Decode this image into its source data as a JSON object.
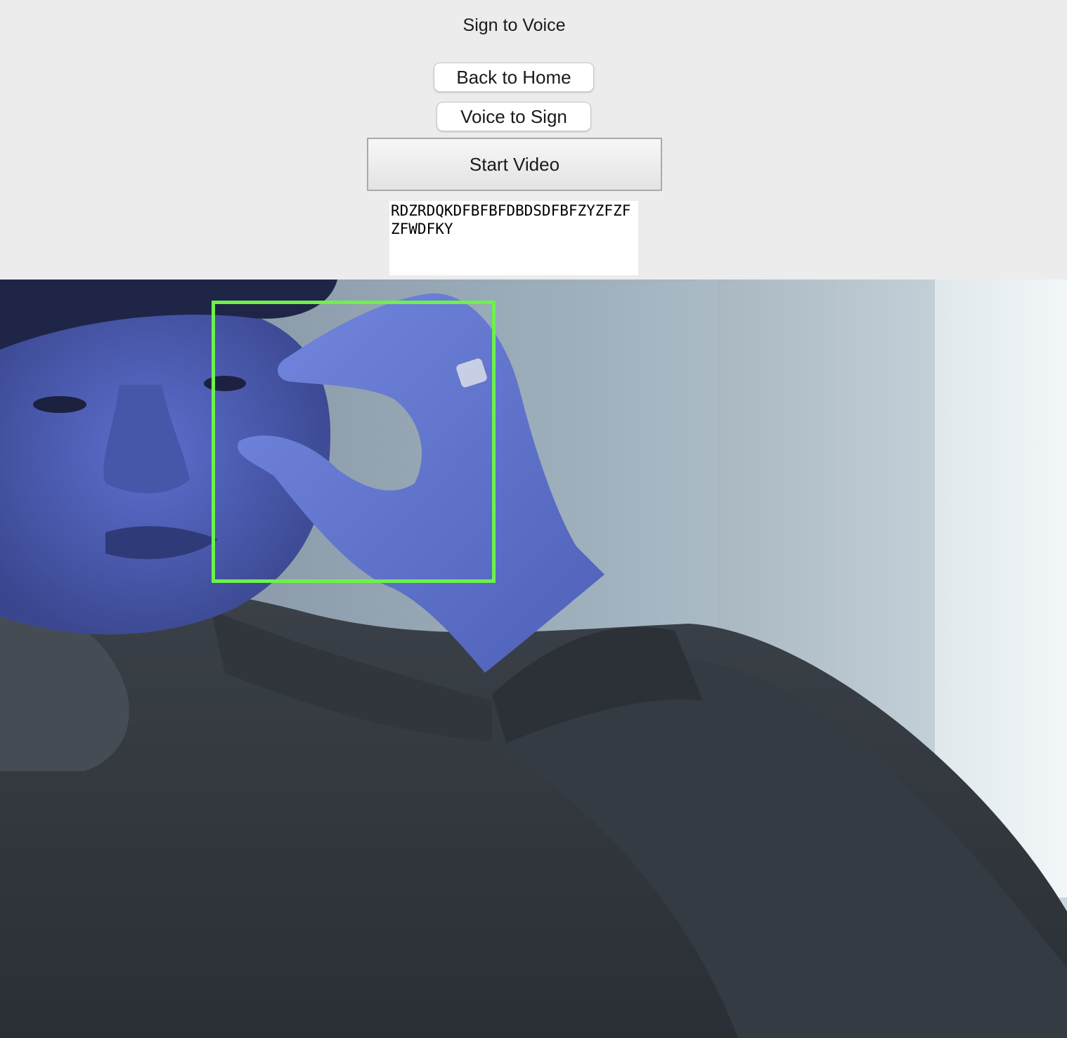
{
  "window": {
    "title": "Sign to Voice"
  },
  "nav": {
    "back_home_label": "Back to Home",
    "voice_to_sign_label": "Voice to Sign"
  },
  "controls": {
    "start_video_label": "Start Video"
  },
  "output": {
    "recognized_text": "RDZRDQKDFBFBFDBDSDFBFZYZFZFZFWDFKY"
  },
  "video": {
    "detection_box_color": "#6cf24a"
  },
  "colors": {
    "window_background": "#ececec",
    "text_area_background": "#ffffff"
  }
}
